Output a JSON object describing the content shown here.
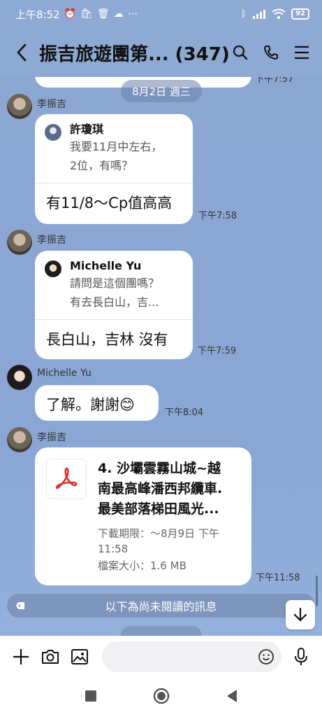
{
  "status_bar": {
    "time": "上午8:52",
    "more": "···",
    "battery": "92"
  },
  "header": {
    "title": "振吉旅遊團第... (347)"
  },
  "chat": {
    "prev_time": "下午7:57",
    "date_chip": "8月2日 週三",
    "messages": [
      {
        "sender": "李振吉",
        "reply_name": "許瓊琪",
        "reply_body_1": "我要11月中左右，",
        "reply_body_2": "2位，有嗎？",
        "text": "有11/8～Cp值高高",
        "time": "下午7:58"
      },
      {
        "sender": "李振吉",
        "reply_name": "Michelle Yu",
        "reply_body_1": "請問是這個團嗎？",
        "reply_body_2": "有去長白山，吉...",
        "text": "長白山，吉林 沒有",
        "time": "下午7:59"
      },
      {
        "sender": "Michelle Yu",
        "text": "了解。謝謝",
        "emoji": "😊",
        "time": "下午8:04"
      },
      {
        "sender": "李振吉",
        "file_name_1": "4. 沙壩雲霧山城~越",
        "file_name_2": "南最高峰潘西邦纜車.",
        "file_name_3": "最美部落梯田風光...",
        "expiry_1": "下載期限：～8月9日 下午",
        "expiry_2": "11:58",
        "size": "檔案大小：1.6 MB",
        "time": "下午11:58"
      }
    ],
    "unread_label": "以下為尚未閱讀的訊息"
  },
  "colors": {
    "background": "#8da7d3",
    "pdf_red": "#e0312b"
  }
}
